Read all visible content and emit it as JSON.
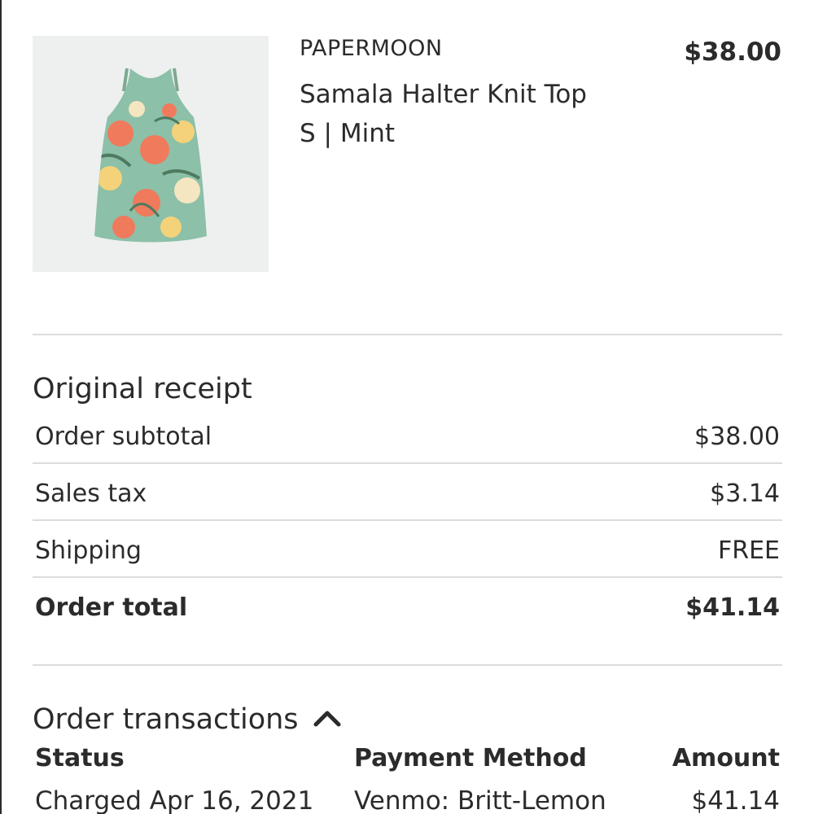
{
  "product": {
    "brand": "PAPERMOON",
    "name": "Samala Halter Knit Top",
    "variant": "S | Mint",
    "price": "$38.00",
    "image_icon": "floral-halter-top-image"
  },
  "receipt": {
    "title": "Original receipt",
    "rows": [
      {
        "label": "Order subtotal",
        "value": "$38.00"
      },
      {
        "label": "Sales tax",
        "value": "$3.14"
      },
      {
        "label": "Shipping",
        "value": "FREE"
      },
      {
        "label": "Order total",
        "value": "$41.14"
      }
    ]
  },
  "transactions": {
    "title": "Order transactions",
    "toggle_icon": "chevron-up-icon",
    "headers": {
      "status": "Status",
      "payment": "Payment Method",
      "amount": "Amount"
    },
    "rows": [
      {
        "status": "Charged Apr 16, 2021",
        "payment": "Venmo: Britt-Lemon",
        "amount": "$41.14"
      }
    ]
  },
  "colors": {
    "text": "#2b2b2b",
    "divider": "#dcdcdc",
    "image_bg": "#eef0f0",
    "mint": "#8cc0a8",
    "coral": "#f07a5c",
    "yellow": "#f4d27a"
  }
}
